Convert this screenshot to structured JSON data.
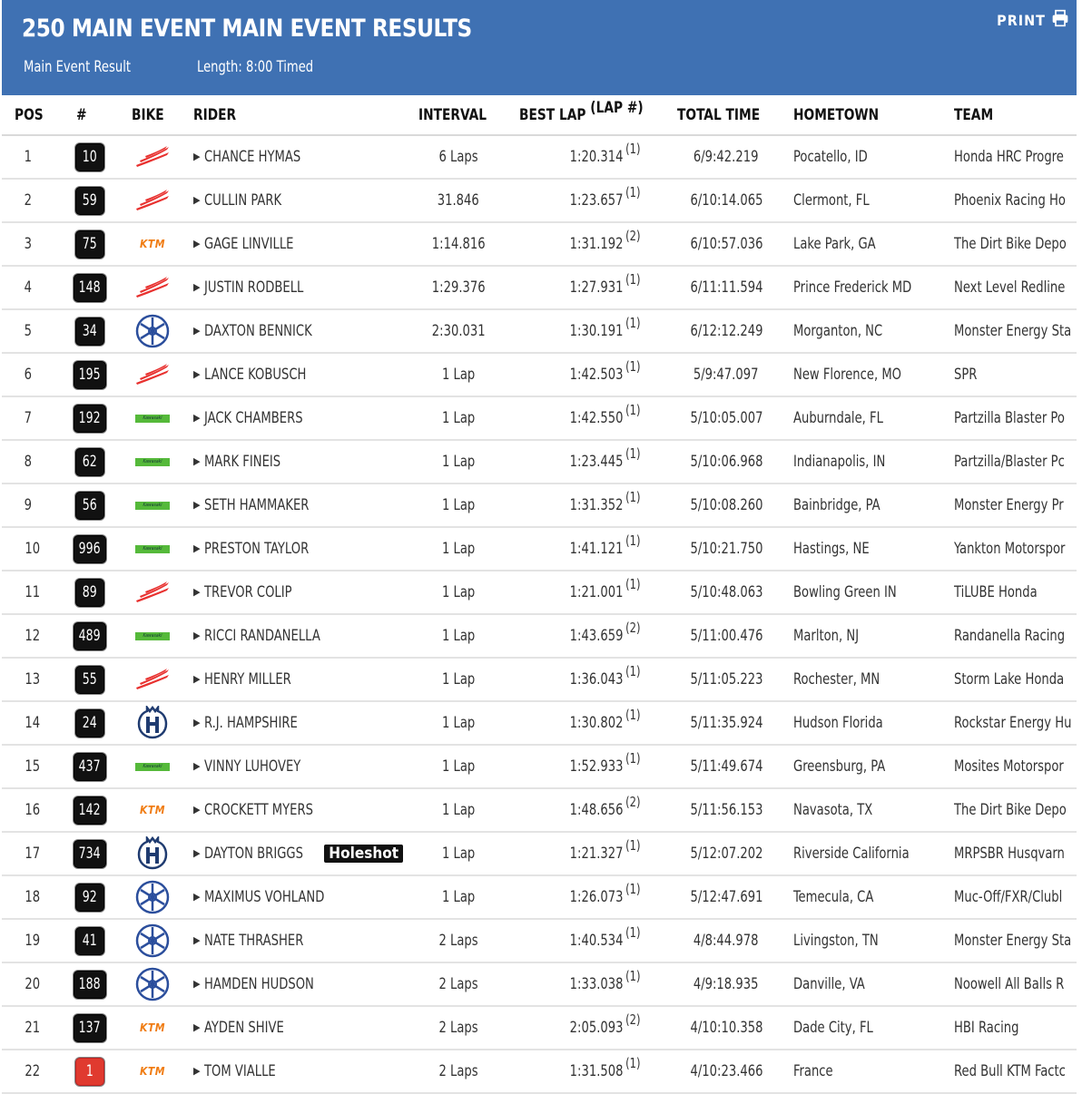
{
  "header": {
    "title": "250 MAIN EVENT MAIN EVENT RESULTS",
    "subtitle": "Main Event Result",
    "length": "Length: 8:00 Timed",
    "print_label": "PRINT"
  },
  "columns": {
    "pos": "POS",
    "num": "#",
    "bike": "BIKE",
    "rider": "RIDER",
    "interval": "INTERVAL",
    "best_lap": "BEST LAP",
    "lap_num": "(LAP #)",
    "total_time": "TOTAL TIME",
    "hometown": "HOMETOWN",
    "team": "TEAM"
  },
  "brand_colors": {
    "header": "#3f71b3",
    "honda": "#e8312f",
    "ktm": "#f07c12",
    "kawasaki": "#55b93a",
    "yamaha": "#2b4e9c",
    "husqvarna": "#1f3b70"
  },
  "rows": [
    {
      "pos": "1",
      "num": "10",
      "bike": "honda",
      "rider": "CHANCE HYMAS",
      "interval": "6 Laps",
      "best": "1:20.314",
      "lap": "(1)",
      "total": "6/9:42.219",
      "hometown": "Pocatello, ID",
      "team": "Honda HRC Progre"
    },
    {
      "pos": "2",
      "num": "59",
      "bike": "honda",
      "rider": "CULLIN PARK",
      "interval": "31.846",
      "best": "1:23.657",
      "lap": "(1)",
      "total": "6/10:14.065",
      "hometown": "Clermont, FL",
      "team": "Phoenix Racing Ho"
    },
    {
      "pos": "3",
      "num": "75",
      "bike": "ktm",
      "rider": "GAGE LINVILLE",
      "interval": "1:14.816",
      "best": "1:31.192",
      "lap": "(2)",
      "total": "6/10:57.036",
      "hometown": "Lake Park, GA",
      "team": "The Dirt Bike Depo"
    },
    {
      "pos": "4",
      "num": "148",
      "bike": "honda",
      "rider": "JUSTIN RODBELL",
      "interval": "1:29.376",
      "best": "1:27.931",
      "lap": "(1)",
      "total": "6/11:11.594",
      "hometown": "Prince Frederick MD",
      "team": "Next Level Redline"
    },
    {
      "pos": "5",
      "num": "34",
      "bike": "yamaha",
      "rider": "DAXTON BENNICK",
      "interval": "2:30.031",
      "best": "1:30.191",
      "lap": "(1)",
      "total": "6/12:12.249",
      "hometown": "Morganton, NC",
      "team": "Monster Energy Sta"
    },
    {
      "pos": "6",
      "num": "195",
      "bike": "honda",
      "rider": "LANCE KOBUSCH",
      "interval": "1 Lap",
      "best": "1:42.503",
      "lap": "(1)",
      "total": "5/9:47.097",
      "hometown": "New Florence, MO",
      "team": "SPR"
    },
    {
      "pos": "7",
      "num": "192",
      "bike": "kawasaki",
      "rider": "JACK CHAMBERS",
      "interval": "1 Lap",
      "best": "1:42.550",
      "lap": "(1)",
      "total": "5/10:05.007",
      "hometown": "Auburndale, FL",
      "team": "Partzilla Blaster Po"
    },
    {
      "pos": "8",
      "num": "62",
      "bike": "kawasaki",
      "rider": "MARK FINEIS",
      "interval": "1 Lap",
      "best": "1:23.445",
      "lap": "(1)",
      "total": "5/10:06.968",
      "hometown": "Indianapolis, IN",
      "team": "Partzilla/Blaster Pc"
    },
    {
      "pos": "9",
      "num": "56",
      "bike": "kawasaki",
      "rider": "SETH HAMMAKER",
      "interval": "1 Lap",
      "best": "1:31.352",
      "lap": "(1)",
      "total": "5/10:08.260",
      "hometown": "Bainbridge, PA",
      "team": "Monster Energy Pr"
    },
    {
      "pos": "10",
      "num": "996",
      "bike": "kawasaki",
      "rider": "PRESTON TAYLOR",
      "interval": "1 Lap",
      "best": "1:41.121",
      "lap": "(1)",
      "total": "5/10:21.750",
      "hometown": "Hastings, NE",
      "team": "Yankton Motorspor"
    },
    {
      "pos": "11",
      "num": "89",
      "bike": "honda",
      "rider": "TREVOR COLIP",
      "interval": "1 Lap",
      "best": "1:21.001",
      "lap": "(1)",
      "total": "5/10:48.063",
      "hometown": "Bowling Green IN",
      "team": "TiLUBE Honda"
    },
    {
      "pos": "12",
      "num": "489",
      "bike": "kawasaki",
      "rider": "RICCI RANDANELLA",
      "interval": "1 Lap",
      "best": "1:43.659",
      "lap": "(2)",
      "total": "5/11:00.476",
      "hometown": "Marlton, NJ",
      "team": "Randanella Racing"
    },
    {
      "pos": "13",
      "num": "55",
      "bike": "honda",
      "rider": "HENRY MILLER",
      "interval": "1 Lap",
      "best": "1:36.043",
      "lap": "(1)",
      "total": "5/11:05.223",
      "hometown": "Rochester, MN",
      "team": "Storm Lake Honda"
    },
    {
      "pos": "14",
      "num": "24",
      "bike": "husqvarna",
      "rider": "R.J. HAMPSHIRE",
      "interval": "1 Lap",
      "best": "1:30.802",
      "lap": "(1)",
      "total": "5/11:35.924",
      "hometown": "Hudson Florida",
      "team": "Rockstar Energy Hu"
    },
    {
      "pos": "15",
      "num": "437",
      "bike": "kawasaki",
      "rider": "VINNY LUHOVEY",
      "interval": "1 Lap",
      "best": "1:52.933",
      "lap": "(1)",
      "total": "5/11:49.674",
      "hometown": "Greensburg, PA",
      "team": "Mosites Motorspor"
    },
    {
      "pos": "16",
      "num": "142",
      "bike": "ktm",
      "rider": "CROCKETT MYERS",
      "interval": "1 Lap",
      "best": "1:48.656",
      "lap": "(2)",
      "total": "5/11:56.153",
      "hometown": "Navasota, TX",
      "team": "The Dirt Bike Depo"
    },
    {
      "pos": "17",
      "num": "734",
      "bike": "husqvarna",
      "rider": "DAYTON BRIGGS",
      "badge": "Holeshot",
      "interval": "1 Lap",
      "best": "1:21.327",
      "lap": "(1)",
      "total": "5/12:07.202",
      "hometown": "Riverside California",
      "team": "MRPSBR Husqvarn"
    },
    {
      "pos": "18",
      "num": "92",
      "bike": "yamaha",
      "rider": "MAXIMUS VOHLAND",
      "interval": "1 Lap",
      "best": "1:26.073",
      "lap": "(1)",
      "total": "5/12:47.691",
      "hometown": "Temecula, CA",
      "team": "Muc-Off/FXR/Clubl"
    },
    {
      "pos": "19",
      "num": "41",
      "bike": "yamaha",
      "rider": "NATE THRASHER",
      "interval": "2 Laps",
      "best": "1:40.534",
      "lap": "(1)",
      "total": "4/8:44.978",
      "hometown": "Livingston, TN",
      "team": "Monster Energy Sta"
    },
    {
      "pos": "20",
      "num": "188",
      "bike": "yamaha",
      "rider": "HAMDEN HUDSON",
      "interval": "2 Laps",
      "best": "1:33.038",
      "lap": "(1)",
      "total": "4/9:18.935",
      "hometown": "Danville, VA",
      "team": "Noowell All Balls R"
    },
    {
      "pos": "21",
      "num": "137",
      "bike": "ktm",
      "rider": "AYDEN SHIVE",
      "interval": "2 Laps",
      "best": "2:05.093",
      "lap": "(2)",
      "total": "4/10:10.358",
      "hometown": "Dade City, FL",
      "team": "HBI Racing"
    },
    {
      "pos": "22",
      "num": "1",
      "num_style": "red",
      "bike": "ktm",
      "rider": "TOM VIALLE",
      "interval": "2 Laps",
      "best": "1:31.508",
      "lap": "(1)",
      "total": "4/10:23.466",
      "hometown": "France",
      "team": "Red Bull KTM Factc"
    }
  ],
  "logo_text": {
    "ktm": "KTM",
    "kawasaki": "Kawasaki"
  }
}
